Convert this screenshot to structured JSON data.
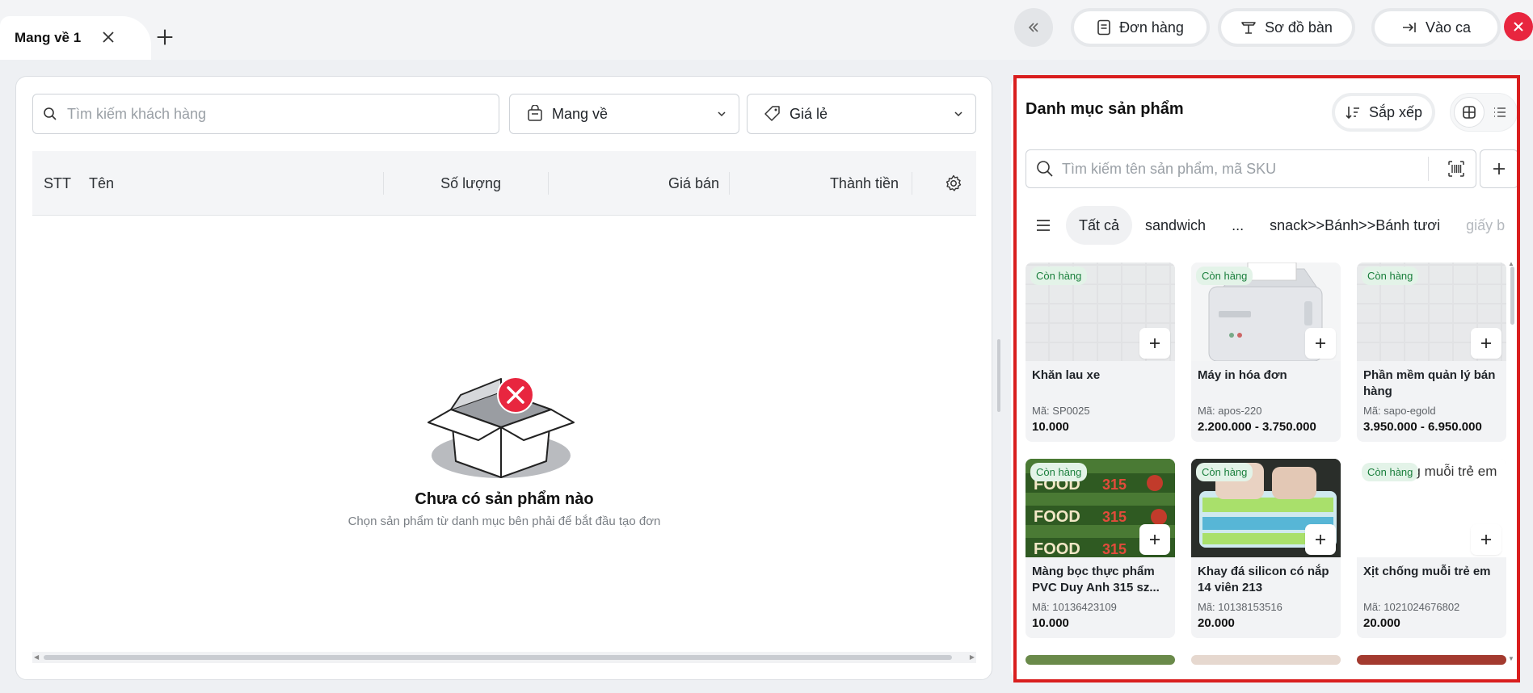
{
  "tabs": [
    {
      "label": "Mang về 1"
    }
  ],
  "header": {
    "orders_label": "Đơn hàng",
    "tables_label": "Sơ đồ bàn",
    "shift_label": "Vào ca"
  },
  "order": {
    "customer_search_placeholder": "Tìm kiếm khách hàng",
    "delivery_type": "Mang về",
    "price_list": "Giá lẻ",
    "columns": {
      "stt": "STT",
      "name": "Tên",
      "qty": "Số lượng",
      "price": "Giá bán",
      "total": "Thành tiền"
    },
    "empty_title": "Chưa có sản phẩm nào",
    "empty_subtitle": "Chọn sản phẩm từ danh mục bên phải để bắt đầu tạo đơn"
  },
  "catalog": {
    "title": "Danh mục sản phẩm",
    "sort_label": "Sắp xếp",
    "search_placeholder": "Tìm kiếm tên sản phẩm, mã SKU",
    "categories": [
      "Tất cả",
      "sandwich",
      "...",
      "snack>>Bánh>>Bánh tươi",
      "giấy b"
    ],
    "products": [
      {
        "badge": "Còn hàng",
        "name": "Khăn lau xe",
        "sku": "Mã: SP0025",
        "price": "10.000",
        "image": "placeholder-pattern"
      },
      {
        "badge": "Còn hàng",
        "name": "Máy in hóa đơn",
        "sku": "Mã: apos-220",
        "price": "2.200.000 - 3.750.000",
        "image": "receipt-printer"
      },
      {
        "badge": "Còn hàng",
        "name": "Phần mềm quản lý bán hàng",
        "sku": "Mã: sapo-egold",
        "price": "3.950.000 - 6.950.000",
        "image": "placeholder-pattern"
      },
      {
        "badge": "Còn hàng",
        "name": "Màng bọc thực phẩm PVC Duy Anh 315 sz...",
        "sku": "Mã: 10136423109",
        "price": "10.000",
        "image": "food-wrap-boxes"
      },
      {
        "badge": "Còn hàng",
        "name": "Khay đá silicon có nắp 14 viên 213",
        "sku": "Mã: 10138153516",
        "price": "20.000",
        "image": "ice-trays"
      },
      {
        "badge": "Còn hàng",
        "name": "Xịt chống muỗi trẻ em",
        "sku": "Mã: 1021024676802",
        "price": "20.000",
        "image": "broken-image",
        "alt_text": "Xịt chống muỗi trẻ em"
      }
    ]
  },
  "colors": {
    "accent_red": "#e8263f",
    "stock_green": "#1a7f3c",
    "highlight": "#d91e1e"
  }
}
